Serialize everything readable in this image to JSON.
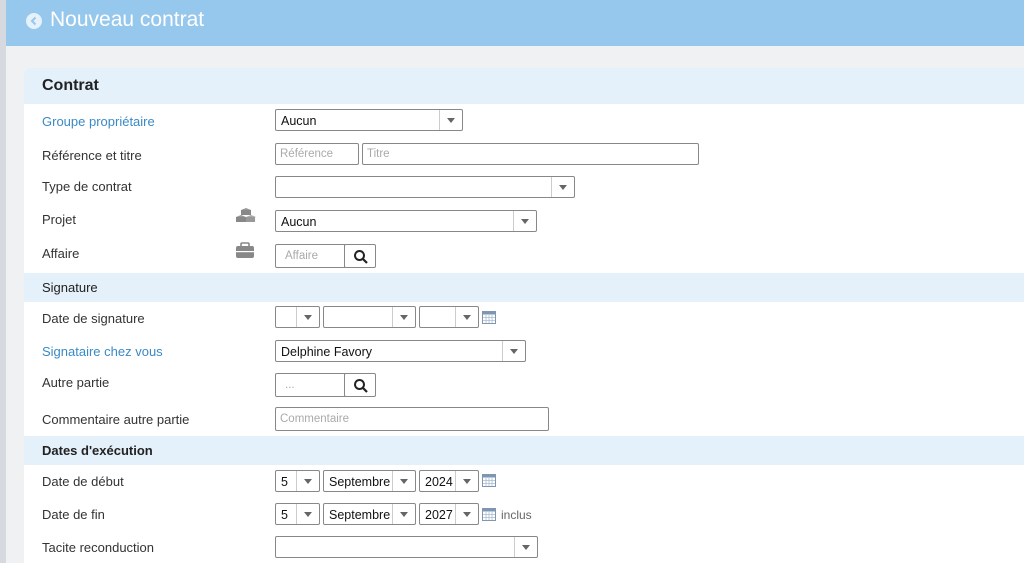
{
  "header": {
    "title": "Nouveau contrat"
  },
  "section_contrat": {
    "title": "Contrat"
  },
  "groupe": {
    "label": "Groupe propriétaire",
    "value": "Aucun"
  },
  "reference": {
    "label": "Référence et titre",
    "ref_placeholder": "Référence",
    "titre_placeholder": "Titre"
  },
  "type": {
    "label": "Type de contrat",
    "value": ""
  },
  "projet": {
    "label": "Projet",
    "value": "Aucun",
    "icon": "projects-icon"
  },
  "affaire": {
    "label": "Affaire",
    "placeholder": "Affaire",
    "icon": "briefcase-icon"
  },
  "section_signature": {
    "title": "Signature"
  },
  "date_signature": {
    "label": "Date de signature",
    "day": "",
    "month": "",
    "year": ""
  },
  "signataire": {
    "label": "Signataire chez vous",
    "value": "Delphine Favory"
  },
  "autre_partie": {
    "label": "Autre partie",
    "placeholder": "..."
  },
  "commentaire": {
    "label": "Commentaire autre partie",
    "placeholder": "Commentaire"
  },
  "section_dates": {
    "title": "Dates d'exécution"
  },
  "date_debut": {
    "label": "Date de début",
    "day": "5",
    "month": "Septembre",
    "year": "2024"
  },
  "date_fin": {
    "label": "Date de fin",
    "day": "5",
    "month": "Septembre",
    "year": "2027",
    "suffix": "inclus"
  },
  "tacite": {
    "label": "Tacite reconduction",
    "value": ""
  },
  "colors": {
    "header": "#96c7ec",
    "section": "#e4f0fa",
    "link_label": "#3a8ac6"
  }
}
